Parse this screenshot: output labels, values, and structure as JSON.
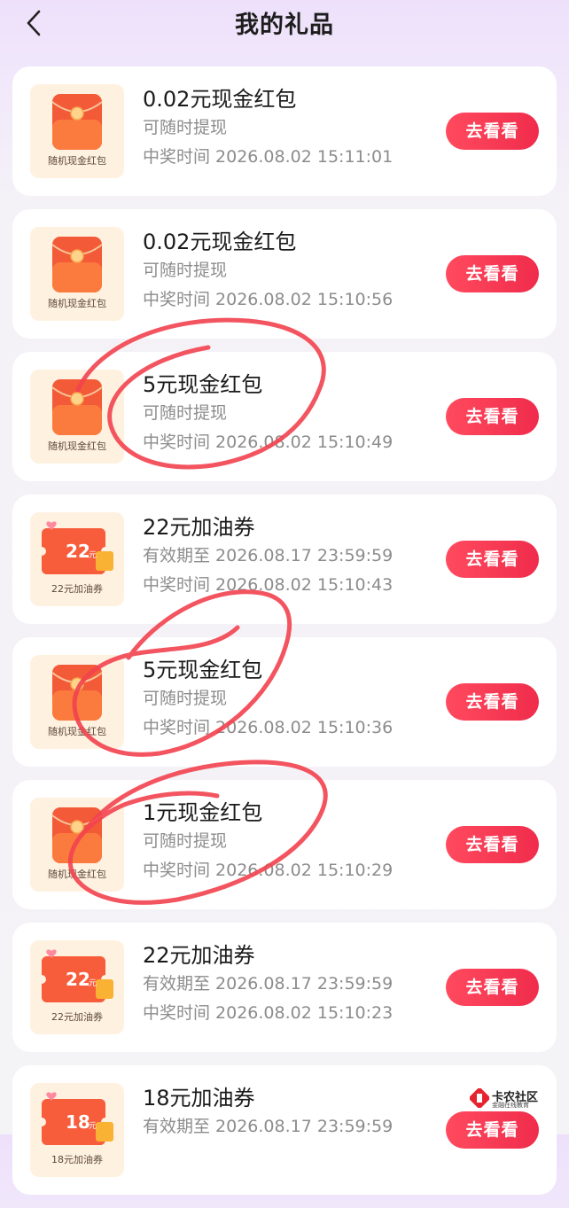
{
  "header": {
    "title": "我的礼品"
  },
  "thumb_labels": {
    "red_packet": "随机现金红包",
    "fuel_22": "22元加油券",
    "fuel_18": "18元加油券"
  },
  "coupon_values": {
    "fuel_22": "22",
    "fuel_18": "18",
    "unit": "元"
  },
  "items": [
    {
      "name": "0.02元现金红包",
      "line1": "可随时提现",
      "line2": "中奖时间  2026.08.02  15:11:01",
      "button": "去看看"
    },
    {
      "name": "0.02元现金红包",
      "line1": "可随时提现",
      "line2": "中奖时间  2026.08.02  15:10:56",
      "button": "去看看"
    },
    {
      "name": "5元现金红包",
      "line1": "可随时提现",
      "line2": "中奖时间  2026.08.02  15:10:49",
      "button": "去看看"
    },
    {
      "name": "22元加油券",
      "line1": "有效期至  2026.08.17  23:59:59",
      "line2": "中奖时间  2026.08.02  15:10:43",
      "button": "去看看"
    },
    {
      "name": "5元现金红包",
      "line1": "可随时提现",
      "line2": "中奖时间  2026.08.02  15:10:36",
      "button": "去看看"
    },
    {
      "name": "1元现金红包",
      "line1": "可随时提现",
      "line2": "中奖时间  2026.08.02  15:10:29",
      "button": "去看看"
    },
    {
      "name": "22元加油券",
      "line1": "有效期至  2026.08.17  23:59:59",
      "line2": "中奖时间  2026.08.02  15:10:23",
      "button": "去看看"
    },
    {
      "name": "18元加油券",
      "line1": "有效期至  2026.08.17  23:59:59",
      "line2": "",
      "button": "去看看"
    }
  ],
  "watermark": {
    "title": "卡农社区",
    "subtitle": "金融在线教育"
  },
  "colors": {
    "accent": "#f03a52",
    "annotation": "#f2424f"
  }
}
